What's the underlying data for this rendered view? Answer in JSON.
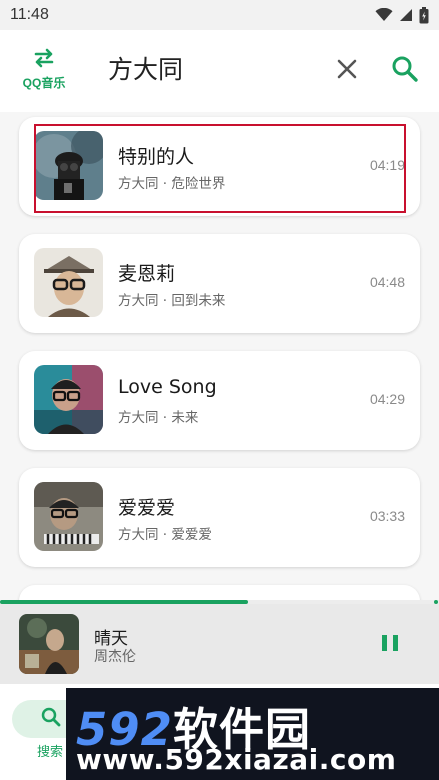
{
  "status_bar": {
    "time": "11:48",
    "icons": [
      "wifi-icon",
      "signal-icon",
      "battery-icon"
    ]
  },
  "header": {
    "app_label": "QQ音乐",
    "search_query": "方大同",
    "icons": [
      "swap-arrows-icon",
      "close-icon",
      "search-icon"
    ]
  },
  "songs": [
    {
      "title": "特别的人",
      "subtitle": "方大同 · 危险世界",
      "duration": "04:19"
    },
    {
      "title": "麦恩莉",
      "subtitle": "方大同 · 回到未来",
      "duration": "04:48"
    },
    {
      "title": "Love Song",
      "subtitle": "方大同 · 未来",
      "duration": "04:29"
    },
    {
      "title": "爱爱爱",
      "subtitle": "方大同 · 爱爱爱",
      "duration": "03:33"
    }
  ],
  "player": {
    "progress": 0.566,
    "title": "晴天",
    "artist": "周杰伦",
    "state_icon": "pause-icon"
  },
  "bottom_nav": {
    "active_label": "搜索",
    "active_icon": "search-icon"
  },
  "watermark": {
    "logo_digits": "592",
    "logo_cn": "软件园",
    "url": "www.592xiazai.com"
  },
  "colors": {
    "accent": "#1aa260",
    "highlight_box": "#c8102e",
    "watermark_bg": "#10141f",
    "watermark_blue": "#4f8df5"
  }
}
